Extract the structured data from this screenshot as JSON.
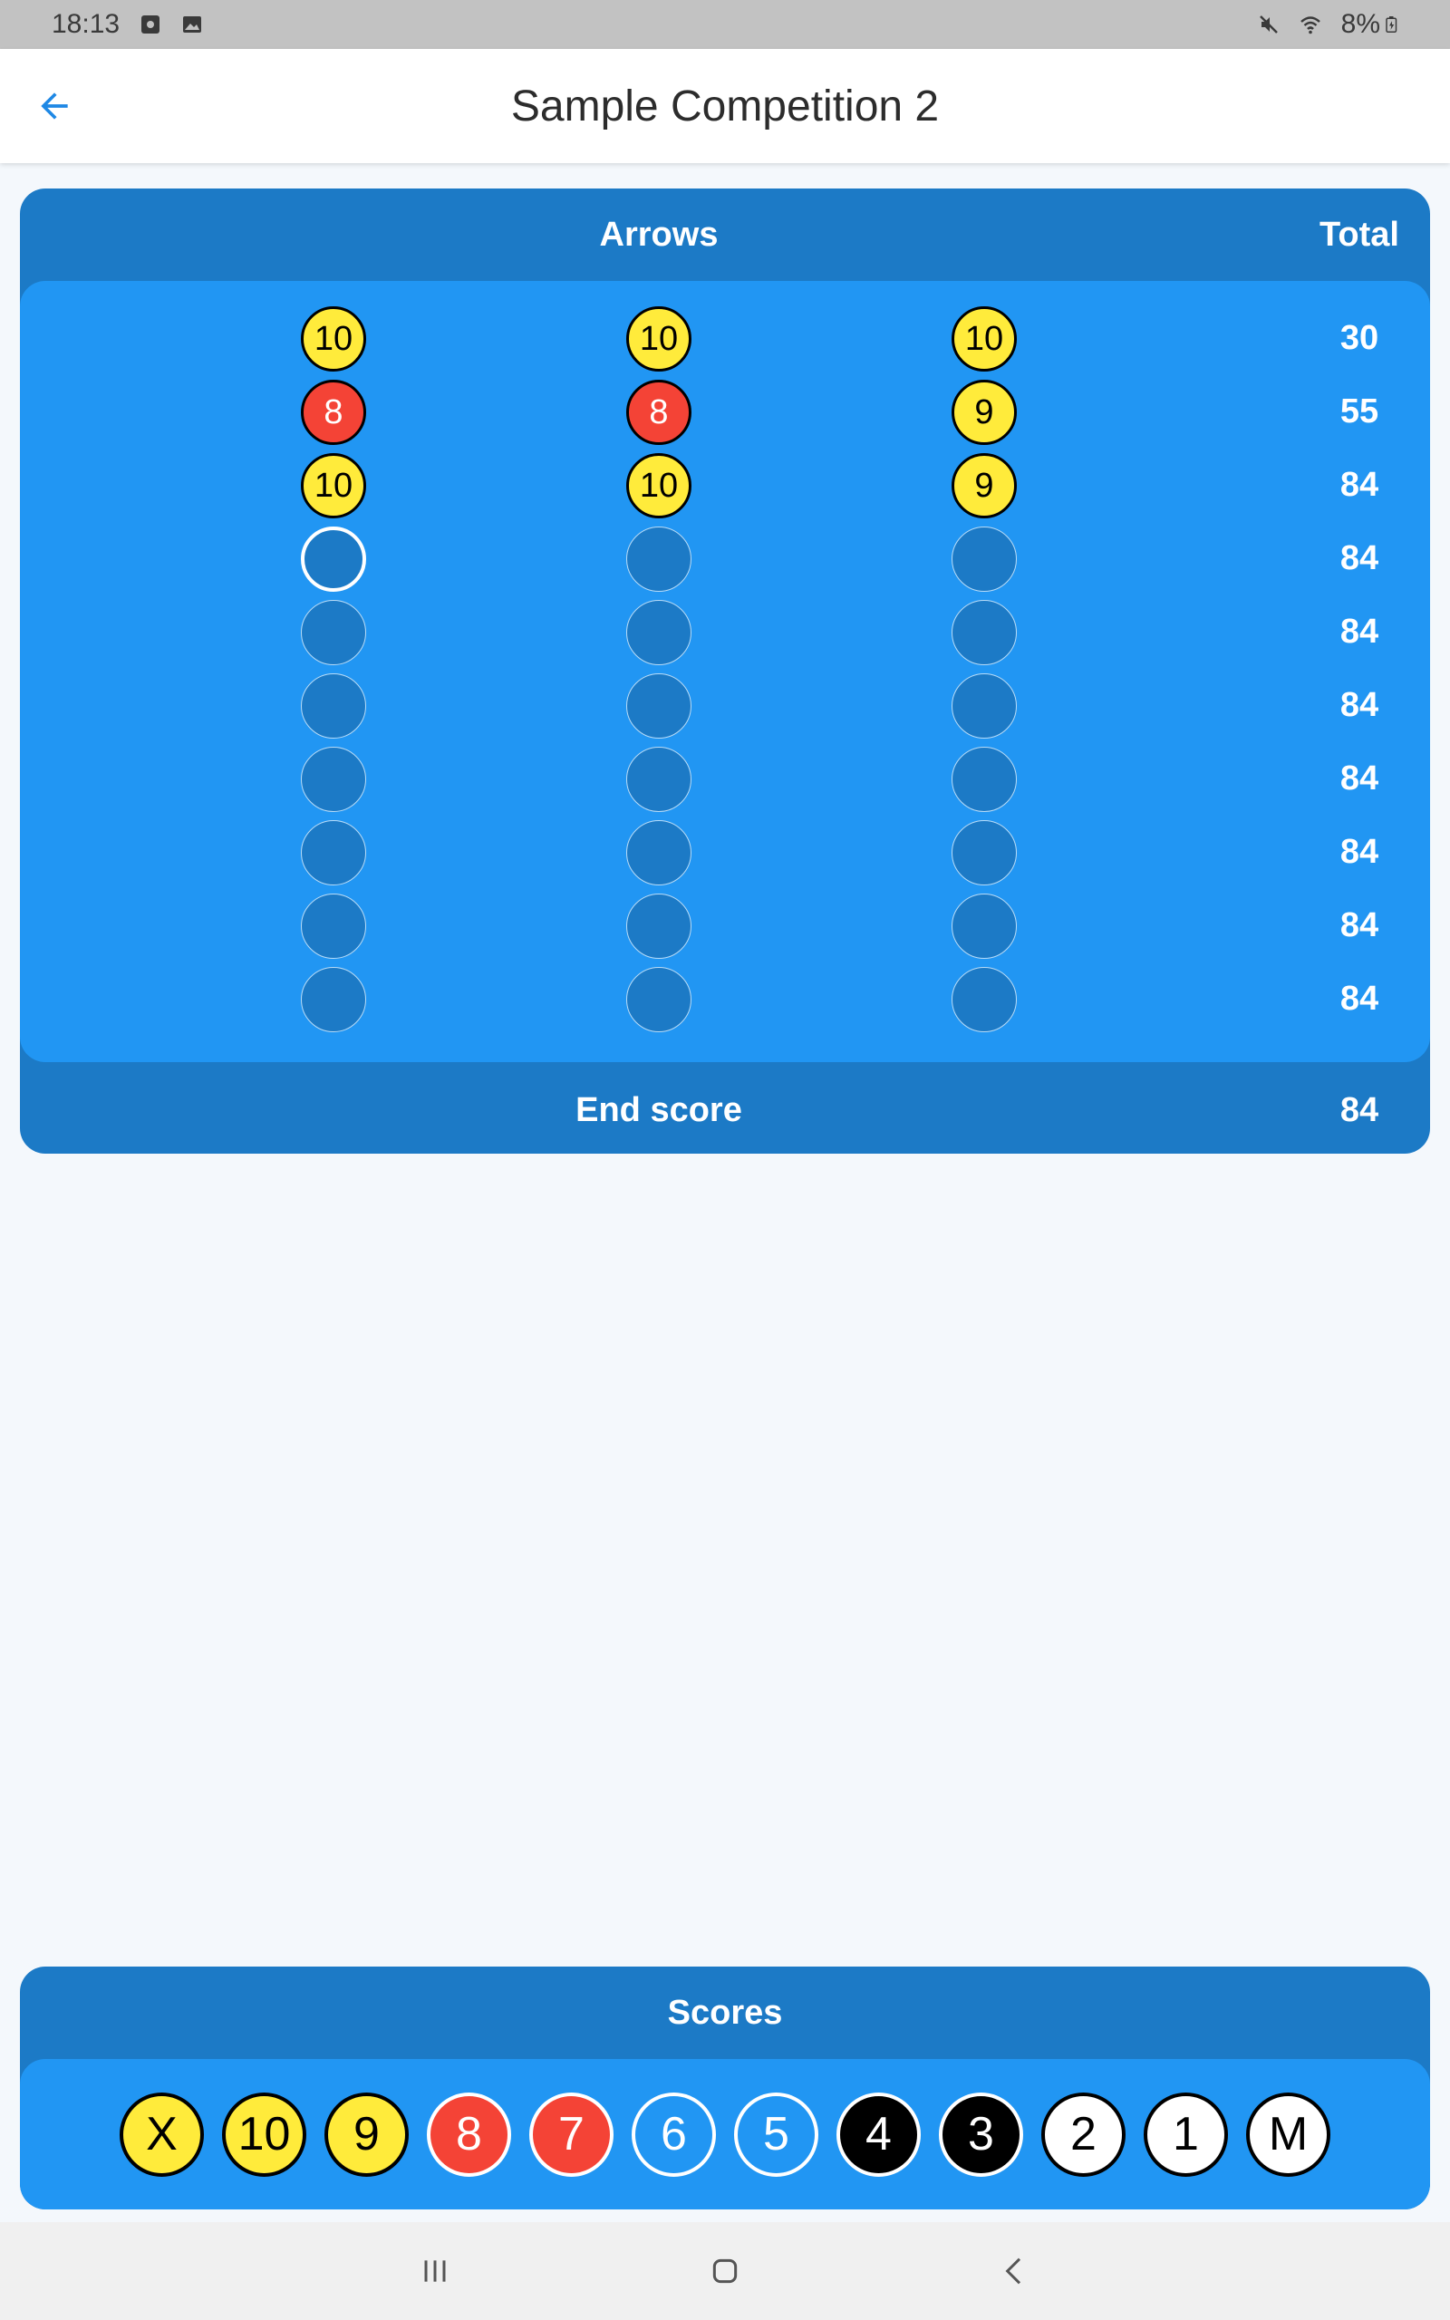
{
  "status_bar": {
    "time": "18:13",
    "battery": "8%"
  },
  "app_bar": {
    "title": "Sample Competition 2"
  },
  "card": {
    "header_arrows": "Arrows",
    "header_total": "Total",
    "rows": [
      {
        "arrows": [
          {
            "v": "10",
            "c": "yellow"
          },
          {
            "v": "10",
            "c": "yellow"
          },
          {
            "v": "10",
            "c": "yellow"
          }
        ],
        "total": "30"
      },
      {
        "arrows": [
          {
            "v": "8",
            "c": "red"
          },
          {
            "v": "8",
            "c": "red"
          },
          {
            "v": "9",
            "c": "yellow"
          }
        ],
        "total": "55"
      },
      {
        "arrows": [
          {
            "v": "10",
            "c": "yellow"
          },
          {
            "v": "10",
            "c": "yellow"
          },
          {
            "v": "9",
            "c": "yellow"
          }
        ],
        "total": "84"
      },
      {
        "arrows": [
          {
            "v": "",
            "c": "selected"
          },
          {
            "v": "",
            "c": "empty"
          },
          {
            "v": "",
            "c": "empty"
          }
        ],
        "total": "84"
      },
      {
        "arrows": [
          {
            "v": "",
            "c": "empty"
          },
          {
            "v": "",
            "c": "empty"
          },
          {
            "v": "",
            "c": "empty"
          }
        ],
        "total": "84"
      },
      {
        "arrows": [
          {
            "v": "",
            "c": "empty"
          },
          {
            "v": "",
            "c": "empty"
          },
          {
            "v": "",
            "c": "empty"
          }
        ],
        "total": "84"
      },
      {
        "arrows": [
          {
            "v": "",
            "c": "empty"
          },
          {
            "v": "",
            "c": "empty"
          },
          {
            "v": "",
            "c": "empty"
          }
        ],
        "total": "84"
      },
      {
        "arrows": [
          {
            "v": "",
            "c": "empty"
          },
          {
            "v": "",
            "c": "empty"
          },
          {
            "v": "",
            "c": "empty"
          }
        ],
        "total": "84"
      },
      {
        "arrows": [
          {
            "v": "",
            "c": "empty"
          },
          {
            "v": "",
            "c": "empty"
          },
          {
            "v": "",
            "c": "empty"
          }
        ],
        "total": "84"
      },
      {
        "arrows": [
          {
            "v": "",
            "c": "empty"
          },
          {
            "v": "",
            "c": "empty"
          },
          {
            "v": "",
            "c": "empty"
          }
        ],
        "total": "84"
      }
    ],
    "footer_label": "End score",
    "footer_value": "84"
  },
  "scores": {
    "title": "Scores",
    "buttons": [
      {
        "v": "X",
        "c": "yellow"
      },
      {
        "v": "10",
        "c": "yellow"
      },
      {
        "v": "9",
        "c": "yellow"
      },
      {
        "v": "8",
        "c": "red"
      },
      {
        "v": "7",
        "c": "red"
      },
      {
        "v": "6",
        "c": "blue"
      },
      {
        "v": "5",
        "c": "blue"
      },
      {
        "v": "4",
        "c": "black"
      },
      {
        "v": "3",
        "c": "black"
      },
      {
        "v": "2",
        "c": "white"
      },
      {
        "v": "1",
        "c": "white"
      },
      {
        "v": "M",
        "c": "white"
      }
    ]
  },
  "colors": {
    "primary": "#2196f3",
    "primary_dark": "#1c7ac6",
    "yellow": "#ffeb3b",
    "red": "#f44336"
  }
}
